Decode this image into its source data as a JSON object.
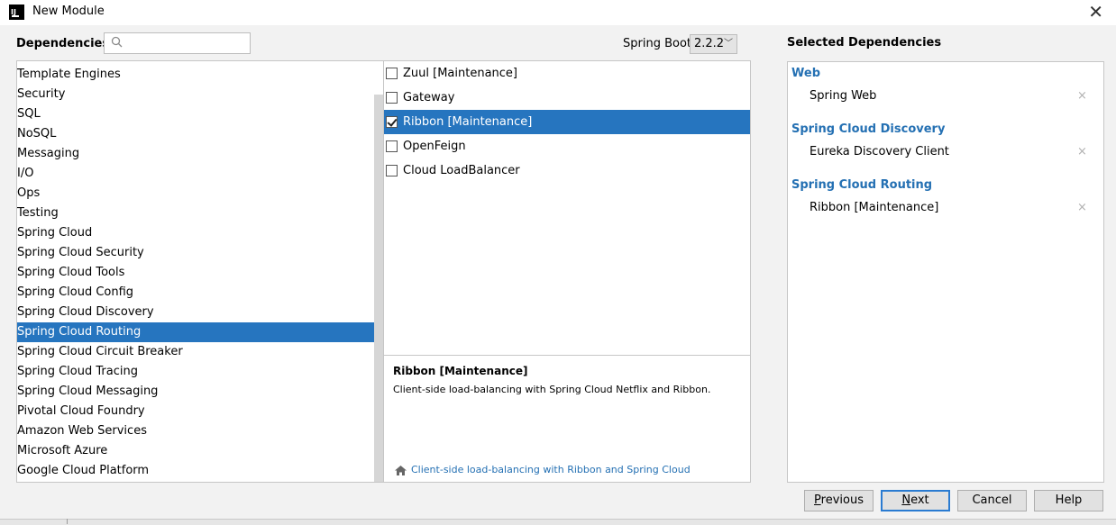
{
  "window": {
    "title": "New Module",
    "app_icon": "intellij-icon",
    "close_icon": "close-icon"
  },
  "header": {
    "dependencies_label": "Dependencies",
    "search": {
      "value": "",
      "placeholder": "",
      "icon": "search-icon"
    },
    "spring_boot_label": "Spring Boot",
    "spring_boot_version": "2.2.2",
    "selected_label": "Selected Dependencies"
  },
  "categories": [
    {
      "label": "Template Engines"
    },
    {
      "label": "Security"
    },
    {
      "label": "SQL"
    },
    {
      "label": "NoSQL"
    },
    {
      "label": "Messaging"
    },
    {
      "label": "I/O"
    },
    {
      "label": "Ops"
    },
    {
      "label": "Testing"
    },
    {
      "label": "Spring Cloud"
    },
    {
      "label": "Spring Cloud Security"
    },
    {
      "label": "Spring Cloud Tools"
    },
    {
      "label": "Spring Cloud Config"
    },
    {
      "label": "Spring Cloud Discovery"
    },
    {
      "label": "Spring Cloud Routing",
      "selected": true
    },
    {
      "label": "Spring Cloud Circuit Breaker"
    },
    {
      "label": "Spring Cloud Tracing"
    },
    {
      "label": "Spring Cloud Messaging"
    },
    {
      "label": "Pivotal Cloud Foundry"
    },
    {
      "label": "Amazon Web Services"
    },
    {
      "label": "Microsoft Azure"
    },
    {
      "label": "Google Cloud Platform"
    }
  ],
  "dependencies": [
    {
      "label": "Zuul [Maintenance]",
      "checked": false,
      "selected": false
    },
    {
      "label": "Gateway",
      "checked": false,
      "selected": false
    },
    {
      "label": "Ribbon [Maintenance]",
      "checked": true,
      "selected": true
    },
    {
      "label": "OpenFeign",
      "checked": false,
      "selected": false
    },
    {
      "label": "Cloud LoadBalancer",
      "checked": false,
      "selected": false
    }
  ],
  "description": {
    "title": "Ribbon [Maintenance]",
    "text": "Client-side load-balancing with Spring Cloud Netflix and Ribbon.",
    "link_icon": "home-icon",
    "link": "Client-side load-balancing with Ribbon and Spring Cloud"
  },
  "selected_groups": [
    {
      "title": "Web",
      "items": [
        "Spring Web"
      ]
    },
    {
      "title": "Spring Cloud Discovery",
      "items": [
        "Eureka Discovery Client"
      ]
    },
    {
      "title": "Spring Cloud Routing",
      "items": [
        "Ribbon [Maintenance]"
      ]
    }
  ],
  "remove_symbol": "×",
  "buttons": {
    "previous_mnemonic": "P",
    "previous_rest": "revious",
    "next_mnemonic": "N",
    "next_rest": "ext",
    "cancel": "Cancel",
    "help": "Help"
  },
  "colors": {
    "selection": "#2675bf",
    "group_title": "#2470b3",
    "link": "#2470b3"
  }
}
